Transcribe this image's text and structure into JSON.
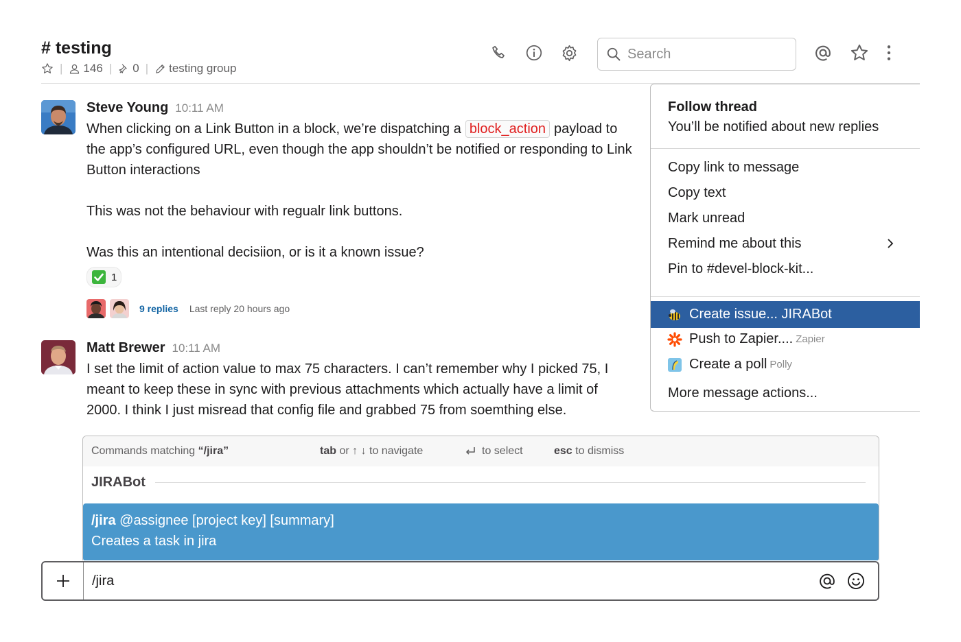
{
  "channel": {
    "title": "# testing",
    "members": "146",
    "pins": "0",
    "topic": "testing group"
  },
  "search": {
    "placeholder": "Search"
  },
  "messages": [
    {
      "author": "Steve Young",
      "time": "10:11 AM",
      "text_before_code": "When clicking on a Link Button in a block, we’re dispatching a",
      "code": "block_action",
      "text_after_code": "payload to the app’s configured URL, even though the app shouldn’t be notified or responding to Link Button interactions",
      "para2": "This was not the behaviour with regualr link buttons.",
      "para3": "Was this an intentional decisiion, or is it a known issue?",
      "reaction_count": "1",
      "replies": "9 replies",
      "last_reply": "Last reply 20 hours ago"
    },
    {
      "author": "Matt Brewer",
      "time": "10:11 AM",
      "text": "I set the limit of action value to max 75 characters. I can’t remember why I picked 75, I meant to keep these in sync with previous attachments which actually have a limit of 2000. I think I just misread that config file and grabbed 75 from soemthing else."
    }
  ],
  "menu": {
    "follow_title": "Follow thread",
    "follow_sub": "You’ll be notified about new replies",
    "items": [
      "Copy link to message",
      "Copy text",
      "Mark unread",
      "Remind me about this",
      "Pin to #devel-block-kit..."
    ],
    "apps": [
      {
        "label": "Create issue... JIRABot",
        "sub": ""
      },
      {
        "label": "Push to Zapier....",
        "sub": "Zapier"
      },
      {
        "label": "Create a poll",
        "sub": "Polly"
      }
    ],
    "more": "More message actions..."
  },
  "commands": {
    "matching_prefix": "Commands matching ",
    "matching_query": "“/jira”",
    "nav_key": "tab",
    "nav_text": " or ↑ ↓ to navigate",
    "select_text": "to select",
    "esc_key": "esc",
    "esc_text": " to dismiss",
    "group": "JIRABot",
    "cmd_name": "/jira",
    "cmd_args": " @assignee [project key] [summary]",
    "cmd_desc": "Creates a task in jira"
  },
  "composer": {
    "value": "/jira"
  },
  "colors": {
    "highlight": "#2c5fa0",
    "command_selected": "#4a98cc",
    "code_text": "#e01e1e",
    "link": "#1264a3"
  }
}
